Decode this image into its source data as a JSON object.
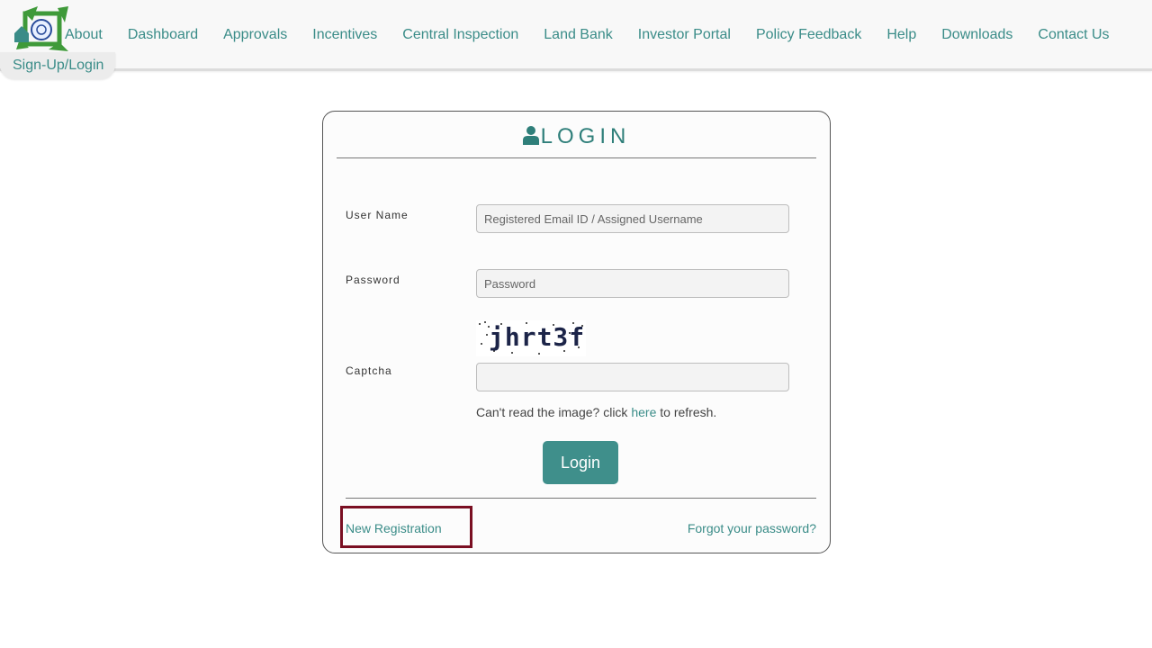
{
  "header": {
    "nav": [
      {
        "label": "About"
      },
      {
        "label": "Dashboard"
      },
      {
        "label": "Approvals"
      },
      {
        "label": "Incentives"
      },
      {
        "label": "Central Inspection"
      },
      {
        "label": "Land Bank"
      },
      {
        "label": "Investor Portal"
      },
      {
        "label": "Policy Feedback"
      },
      {
        "label": "Help"
      },
      {
        "label": "Downloads"
      },
      {
        "label": "Contact Us"
      }
    ],
    "signup_label": "Sign-Up/Login",
    "logo_icon": "jharkhand-emblem-logo",
    "home_icon": "home-icon"
  },
  "login": {
    "title": "LOGIN",
    "title_icon": "user-icon",
    "username_label": "User Name",
    "username_placeholder": "Registered Email ID / Assigned Username",
    "username_value": "",
    "password_label": "Password",
    "password_placeholder": "Password",
    "password_value": "",
    "captcha_label": "Captcha",
    "captcha_text": "jhrt3f",
    "captcha_value": "",
    "refresh_prefix": "Can't read the image? click",
    "refresh_link": "here",
    "refresh_suffix": "to refresh.",
    "submit_label": "Login",
    "new_registration": "New Registration",
    "forgot_password": "Forgot your password?"
  },
  "colors": {
    "accent": "#3a8c88",
    "button": "#3f8f8b",
    "highlight": "#7a0f22"
  }
}
